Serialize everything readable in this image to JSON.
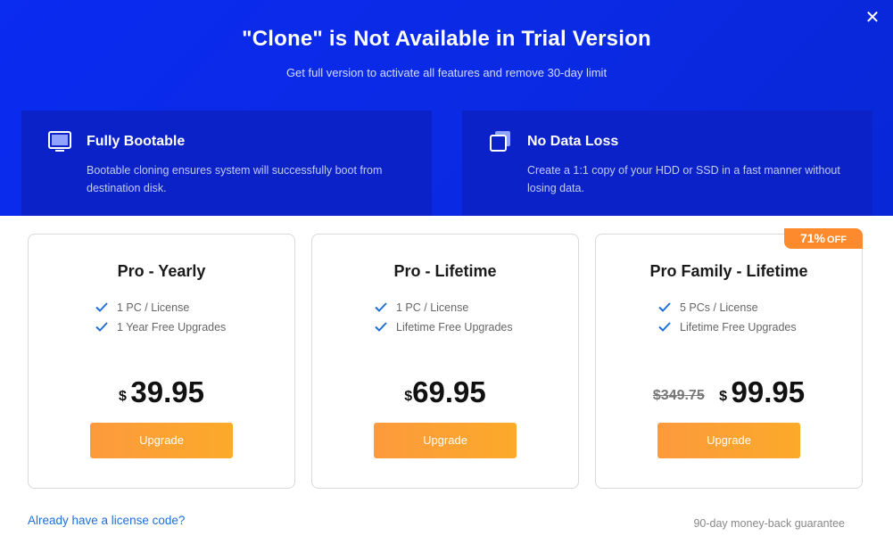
{
  "header": {
    "title": "\"Clone\" is Not Available in Trial Version",
    "subtitle": "Get full version to activate all features and remove 30-day limit",
    "close_icon": "close-icon"
  },
  "features": [
    {
      "icon": "monitor-icon",
      "title": "Fully Bootable",
      "desc": "Bootable cloning ensures system will successfully boot from destination disk."
    },
    {
      "icon": "copy-icon",
      "title": "No Data Loss",
      "desc": "Create a 1:1 copy of your HDD or SSD in a fast manner without losing data."
    }
  ],
  "plans": [
    {
      "name": "Pro - Yearly",
      "features": [
        "1 PC / License",
        "1 Year Free Upgrades"
      ],
      "currency": "$",
      "price": "39.95",
      "button": "Upgrade"
    },
    {
      "name": "Pro - Lifetime",
      "features": [
        "1 PC / License",
        "Lifetime Free Upgrades"
      ],
      "currency": "$",
      "price": "69.95",
      "button": "Upgrade"
    },
    {
      "name": "Pro Family - Lifetime",
      "features": [
        "5 PCs / License",
        "Lifetime Free Upgrades"
      ],
      "old_price": "$349.75",
      "currency": "$",
      "price": "99.95",
      "button": "Upgrade",
      "badge_pct": "71%",
      "badge_off": "OFF"
    }
  ],
  "footer": {
    "license_link": "Already have a license code?",
    "guarantee": "90-day money-back guarantee"
  },
  "colors": {
    "hero_blue": "#0a2bf0",
    "accent_orange": "#fd9a3d",
    "check_blue": "#1e6fd6",
    "link_blue": "#1e6fd6"
  }
}
